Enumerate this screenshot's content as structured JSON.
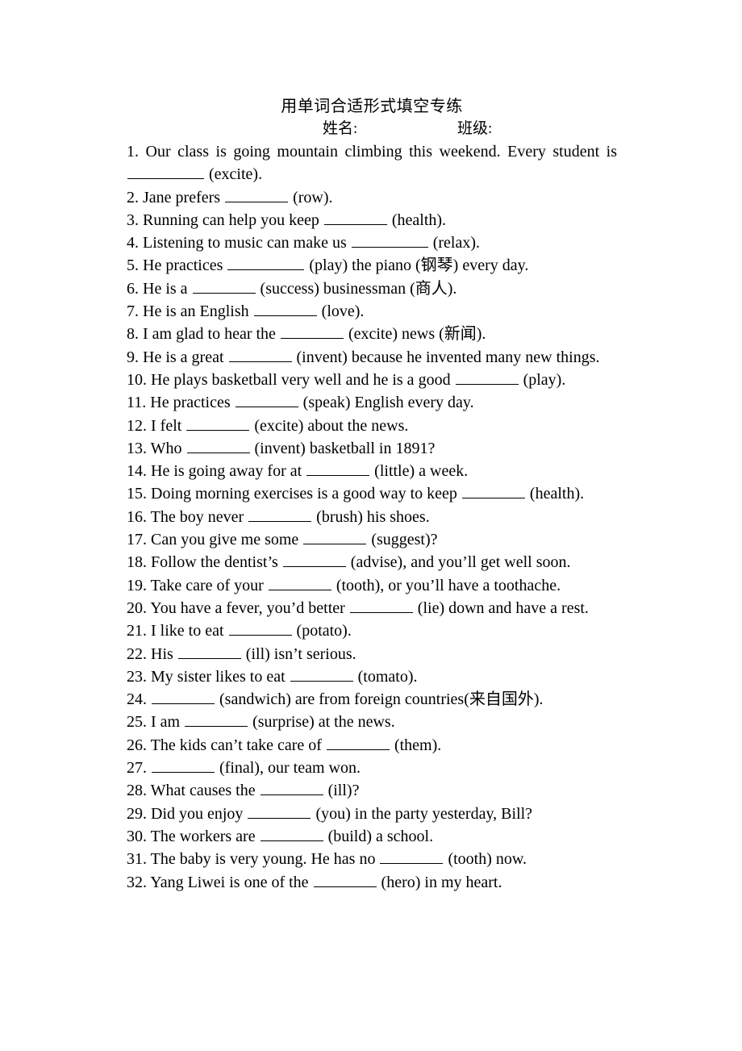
{
  "document": {
    "title": "用单词合适形式填空专练",
    "header": {
      "name_label": "姓名:",
      "class_label": "班级:"
    },
    "questions": [
      {
        "number": "1.",
        "parts": [
          "1. Our class is going mountain climbing this weekend. Every student is ",
          {
            "blank": "lg"
          },
          " (excite)."
        ],
        "text_before": "1. Our class is going mountain climbing this weekend. Every student is",
        "blank_size": "lg",
        "text_after": "(excite).",
        "justify": true
      },
      {
        "number": "2.",
        "text_before": "2. Jane prefers",
        "blank_size": "md",
        "text_after": "(row).",
        "justify": false
      },
      {
        "number": "3.",
        "text_before": "3. Running can help you keep",
        "blank_size": "md",
        "text_after": "(health).",
        "justify": false
      },
      {
        "number": "4.",
        "text_before": "4. Listening to music can make us",
        "blank_size": "lg",
        "text_after": "(relax).",
        "justify": false
      },
      {
        "number": "5.",
        "text_before": "5. He practices",
        "blank_size": "lg",
        "text_after": "(play) the piano (钢琴) every day.",
        "justify": false
      },
      {
        "number": "6.",
        "text_before": "6. He is a",
        "blank_size": "md",
        "text_after": "(success) businessman (商人).",
        "justify": false
      },
      {
        "number": "7.",
        "text_before": "7. He is an English",
        "blank_size": "md",
        "text_after": "(love).",
        "justify": false
      },
      {
        "number": "8.",
        "text_before": "8. I am glad to hear the",
        "blank_size": "md",
        "text_after": "(excite) news (新闻).",
        "justify": false
      },
      {
        "number": "9.",
        "text_before": "9. He is a great",
        "blank_size": "md",
        "text_after": "(invent) because he invented many new things.",
        "justify": true
      },
      {
        "number": "10.",
        "text_before": "10. He plays basketball very well and he is a good",
        "blank_size": "md",
        "text_after": "(play).",
        "justify": false
      },
      {
        "number": "11.",
        "text_before": "11. He practices",
        "blank_size": "md",
        "text_after": "(speak) English every day.",
        "justify": false
      },
      {
        "number": "12.",
        "text_before": "12. I felt",
        "blank_size": "md",
        "text_after": "(excite) about the news.",
        "justify": false
      },
      {
        "number": "13.",
        "text_before": "13. Who",
        "blank_size": "md",
        "text_after": "(invent) basketball in 1891?",
        "justify": false
      },
      {
        "number": "14.",
        "text_before": "14. He is going away for at",
        "blank_size": "md",
        "text_after": "(little) a week.",
        "justify": false
      },
      {
        "number": "15.",
        "text_before": "15. Doing morning exercises is a good way to keep",
        "blank_size": "md",
        "text_after": "(health).",
        "justify": false
      },
      {
        "number": "16.",
        "text_before": "16. The boy never",
        "blank_size": "md",
        "text_after": "(brush) his shoes.",
        "justify": false
      },
      {
        "number": "17.",
        "text_before": "17. Can you give me some",
        "blank_size": "md",
        "text_after": "(suggest)?",
        "justify": false
      },
      {
        "number": "18.",
        "text_before": "18. Follow the dentist’s",
        "blank_size": "md",
        "text_after": "(advise), and you’ll get well soon.",
        "justify": false
      },
      {
        "number": "19.",
        "text_before": "19. Take care of your",
        "blank_size": "md",
        "text_after": "(tooth), or you’ll have a toothache.",
        "justify": false
      },
      {
        "number": "20.",
        "text_before": "20. You have a fever, you’d better",
        "blank_size": "md",
        "text_after": "(lie) down and have a rest.",
        "justify": true
      },
      {
        "number": "21.",
        "text_before": "21. I like to eat",
        "blank_size": "md",
        "text_after": "(potato).",
        "justify": false
      },
      {
        "number": "22.",
        "text_before": "22. His",
        "blank_size": "md",
        "text_after": "(ill) isn’t serious.",
        "justify": false
      },
      {
        "number": "23.",
        "text_before": "23. My sister likes to eat",
        "blank_size": "md",
        "text_after": "(tomato).",
        "justify": false
      },
      {
        "number": "24.",
        "text_before": "24.",
        "blank_size": "md",
        "text_after": "(sandwich) are from foreign countries(来自国外).",
        "justify": false
      },
      {
        "number": "25.",
        "text_before": "25. I am",
        "blank_size": "md",
        "text_after": "(surprise) at the news.",
        "justify": false
      },
      {
        "number": "26.",
        "text_before": "26. The kids can’t take care of",
        "blank_size": "md",
        "text_after": "(them).",
        "justify": false
      },
      {
        "number": "27.",
        "text_before": "27.",
        "blank_size": "md",
        "text_after": "(final), our team won.",
        "justify": false
      },
      {
        "number": "28.",
        "text_before": "28. What causes the",
        "blank_size": "md",
        "text_after": "(ill)?",
        "justify": false
      },
      {
        "number": "29.",
        "text_before": "29. Did you enjoy",
        "blank_size": "md",
        "text_after": "(you) in the party yesterday, Bill?",
        "justify": false
      },
      {
        "number": "30.",
        "text_before": "30. The workers are",
        "blank_size": "md",
        "text_after": "(build) a school.",
        "justify": false
      },
      {
        "number": "31.",
        "text_before": "31. The baby is very young. He has no",
        "blank_size": "md",
        "text_after": "(tooth) now.",
        "justify": false
      },
      {
        "number": "32.",
        "text_before": "32. Yang Liwei is one of the",
        "blank_size": "md",
        "text_after": "(hero) in my heart.",
        "justify": false
      }
    ]
  }
}
